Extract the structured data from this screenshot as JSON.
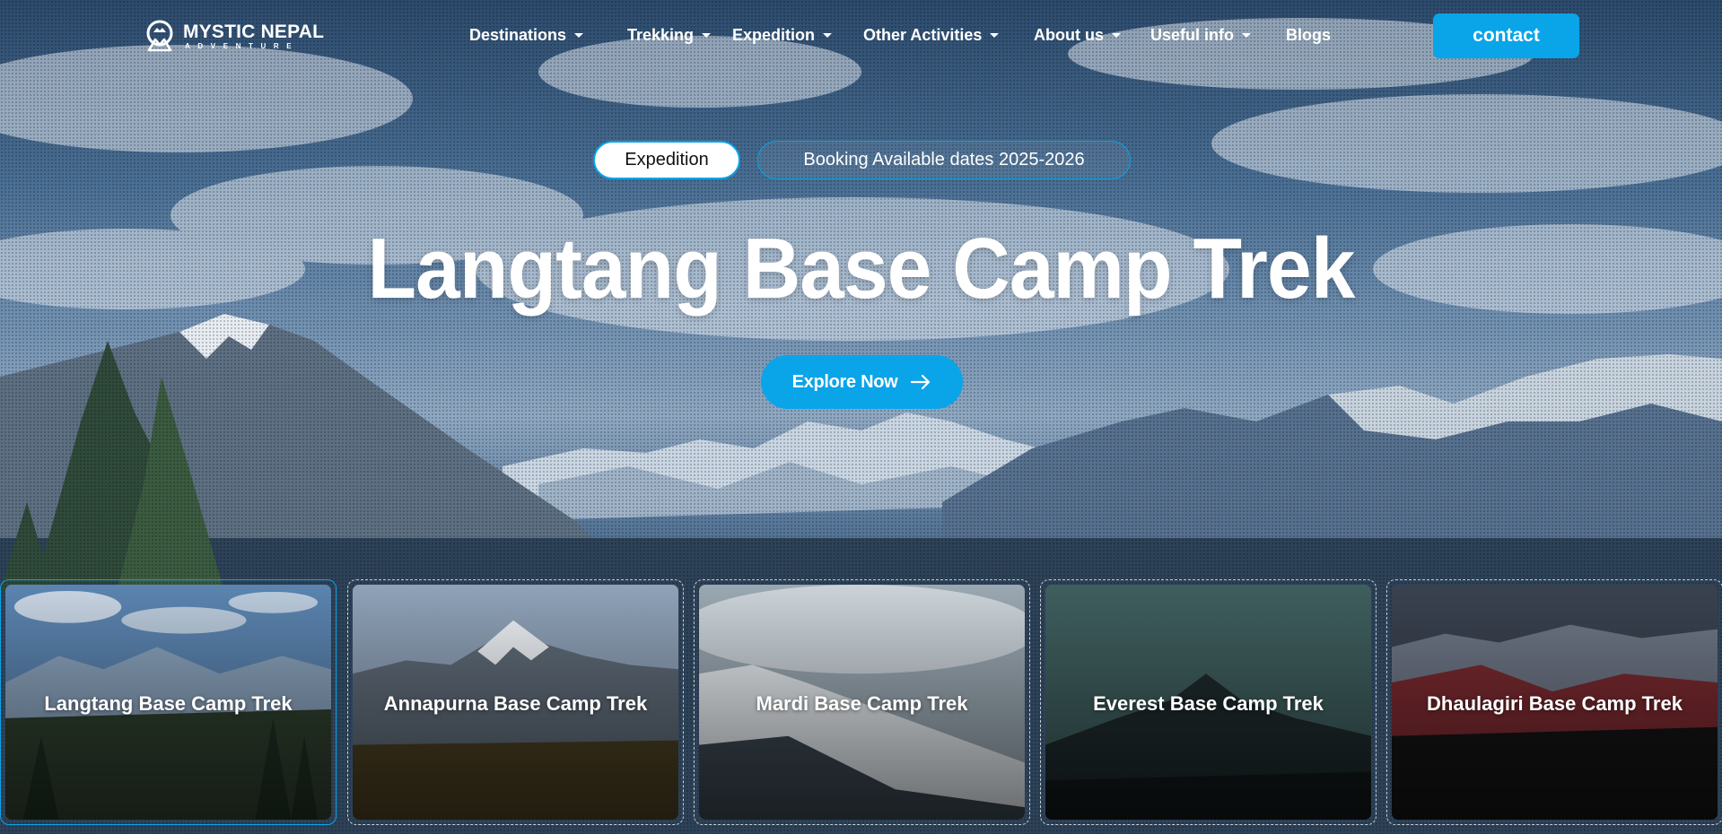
{
  "brand": {
    "name": "MYSTIC NEPAL",
    "tagline": "ADVENTURE",
    "accent_color": "#0aa4e8"
  },
  "nav": {
    "items": [
      {
        "label": "Destinations",
        "has_dropdown": true
      },
      {
        "label": "Trekking",
        "has_dropdown": true
      },
      {
        "label": "Expedition",
        "has_dropdown": true
      },
      {
        "label": "Other Activities",
        "has_dropdown": true
      },
      {
        "label": "About us",
        "has_dropdown": true
      },
      {
        "label": "Useful info",
        "has_dropdown": true
      },
      {
        "label": "Blogs",
        "has_dropdown": false
      }
    ],
    "contact_label": "contact"
  },
  "hero": {
    "badge_primary": "Expedition",
    "badge_secondary": "Booking Available dates 2025-2026",
    "title": "Langtang Base Camp Trek",
    "cta_label": "Explore Now",
    "cta_icon": "arrow-right-icon"
  },
  "cards": [
    {
      "title": "Langtang Base Camp Trek",
      "active": true
    },
    {
      "title": "Annapurna Base Camp Trek",
      "active": false
    },
    {
      "title": "Mardi Base Camp Trek",
      "active": false
    },
    {
      "title": "Everest Base Camp Trek",
      "active": false
    },
    {
      "title": "Dhaulagiri Base Camp Trek",
      "active": false
    }
  ]
}
